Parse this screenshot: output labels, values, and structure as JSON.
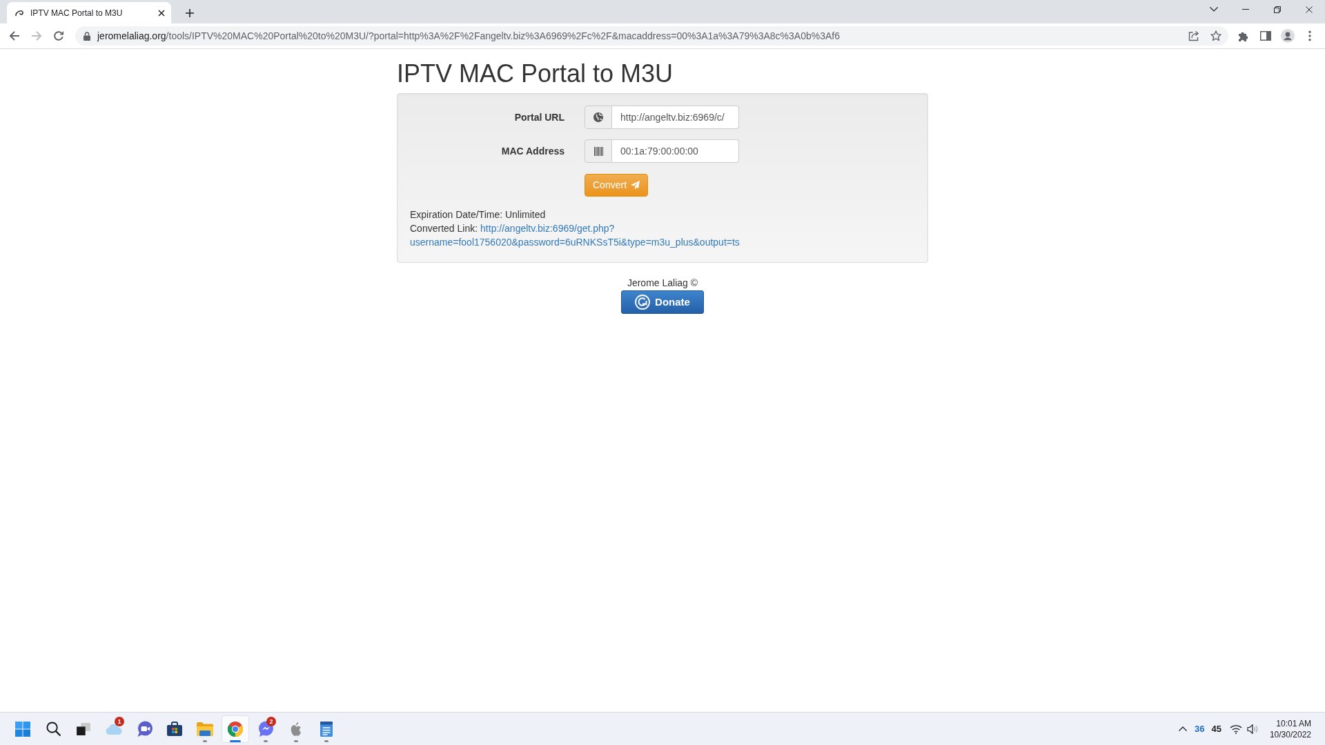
{
  "browser": {
    "tabs": [
      {
        "title": "IPTV MAC Portal to M3U",
        "selected": true
      }
    ],
    "nav_buttons": [
      {
        "kind": "back",
        "disabled": false
      },
      {
        "kind": "forward",
        "disabled": true
      },
      {
        "kind": "reload",
        "disabled": false
      }
    ],
    "address": {
      "host": "jeromelaliag.org",
      "path": "/tools/IPTV%20MAC%20Portal%20to%20M3U/?portal=http%3A%2F%2Fangeltv.biz%3A6969%2Fc%2F&macaddress=00%3A1a%3A79%3A8c%3A0b%3Af6"
    }
  },
  "page": {
    "title": "IPTV MAC Portal to M3U",
    "form": {
      "fields": [
        {
          "label": "Portal URL",
          "kind": "globe",
          "value": "http://angeltv.biz:6969/c/"
        },
        {
          "label": "MAC Address",
          "kind": "barcode",
          "value": "00:1a:79:00:00:00"
        }
      ],
      "submit": "Convert"
    },
    "result": {
      "expiration": "Expiration Date/Time: Unlimited",
      "link_label": "Converted Link:",
      "link_lines": [
        "http://angeltv.biz:6969/get.php?",
        "username=fool1756020&password=6uRNKSsT5i&type=m3u_plus&output=ts"
      ]
    },
    "footer": {
      "credit": "Jerome Laliag ©",
      "donate": "Donate"
    }
  },
  "taskbar": {
    "apps": [
      {
        "kind": "start",
        "running": false,
        "selected": false
      },
      {
        "kind": "search",
        "running": false,
        "selected": false
      },
      {
        "kind": "task_view",
        "running": false,
        "selected": false
      },
      {
        "kind": "weather",
        "running": false,
        "selected": false,
        "badge": "1"
      },
      {
        "kind": "video_chat",
        "running": false,
        "selected": false
      },
      {
        "kind": "store",
        "running": false,
        "selected": false
      },
      {
        "kind": "folder",
        "running": true,
        "selected": false
      },
      {
        "kind": "browser",
        "running": true,
        "selected": true
      },
      {
        "kind": "messenger",
        "running": true,
        "selected": false,
        "badge": "2"
      },
      {
        "kind": "apple",
        "running": true,
        "selected": false
      },
      {
        "kind": "notepad",
        "running": true,
        "selected": false
      }
    ],
    "tray": {
      "readings": [
        {
          "text": "36",
          "color": "#1f6fc5"
        },
        {
          "text": "45",
          "color": "#1b1b1b"
        }
      ],
      "time": "10:01 AM",
      "date": "10/30/2022"
    }
  }
}
